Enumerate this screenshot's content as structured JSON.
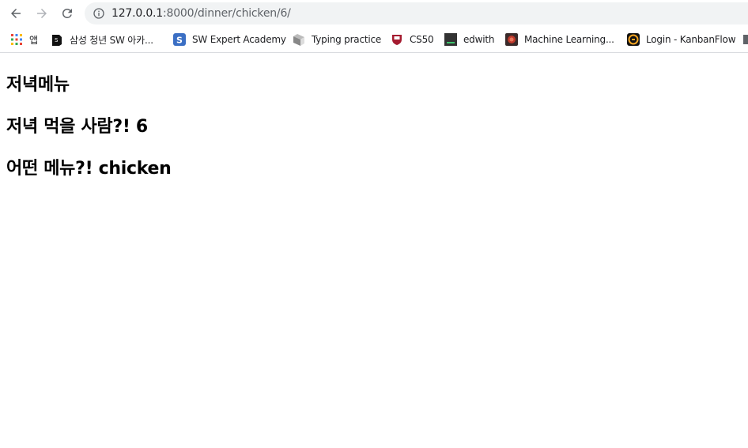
{
  "browser": {
    "address": {
      "host": "127.0.0.1",
      "path": ":8000/dinner/chicken/6/"
    },
    "bookmarks": [
      {
        "label": "앱",
        "icon": "apps-grid-icon"
      },
      {
        "label": "삼성 청년 SW 아카...",
        "icon": "samsung-ssafy-icon"
      },
      {
        "label": "SW Expert Academy",
        "icon": "swea-icon"
      },
      {
        "label": "Typing practice",
        "icon": "typing-icon"
      },
      {
        "label": "CS50",
        "icon": "harvard-shield-icon"
      },
      {
        "label": "edwith",
        "icon": "edwith-icon"
      },
      {
        "label": "Machine Learning...",
        "icon": "ml-icon"
      },
      {
        "label": "Login - KanbanFlow",
        "icon": "kanbanflow-icon"
      }
    ]
  },
  "page": {
    "heading1": "저녁메뉴",
    "heading2": "저녁 먹을 사람?! 6",
    "heading3": "어떤 메뉴?! chicken"
  }
}
